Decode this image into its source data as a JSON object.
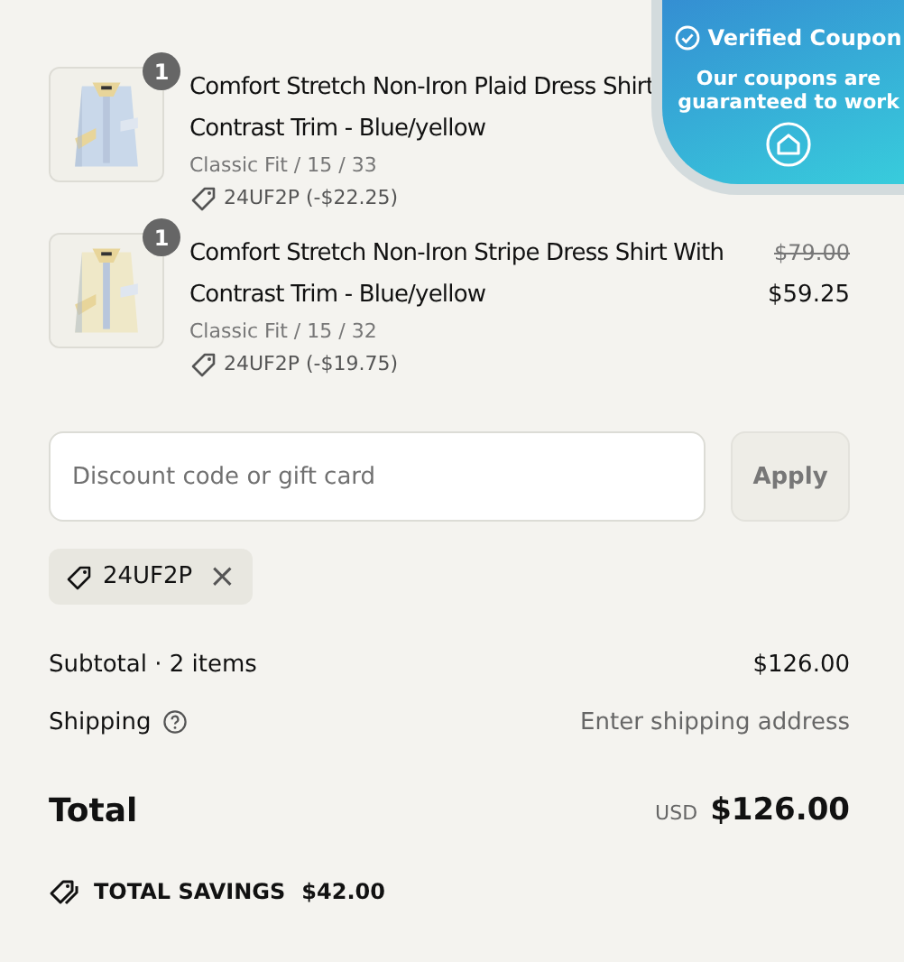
{
  "items": [
    {
      "quantity": "1",
      "title_lines": [
        "Comfort Stretch Non-Iron Plaid Dress Shirt",
        "Contrast Trim - Blue/yellow"
      ],
      "variant": "Classic Fit / 15 / 33",
      "discount": "24UF2P (-$22.25)"
    },
    {
      "quantity": "1",
      "title_lines": [
        "Comfort Stretch Non-Iron Stripe Dress Shirt With",
        "Contrast Trim - Blue/yellow"
      ],
      "variant": "Classic Fit / 15 / 32",
      "discount": "24UF2P (-$19.75)",
      "original_price": "$79.00",
      "price": "$59.25"
    }
  ],
  "discount_field": {
    "placeholder": "Discount code or gift card"
  },
  "apply_button": {
    "label": "Apply",
    "disabled": true
  },
  "applied_codes": [
    {
      "code": "24UF2P",
      "remove": "×"
    }
  ],
  "subtotal": {
    "label": "Subtotal · 2 items",
    "value": "$126.00"
  },
  "shipping": {
    "label": "Shipping",
    "value": "Enter shipping address"
  },
  "total": {
    "label": "Total",
    "currency": "USD",
    "value": "$126.00"
  },
  "savings": {
    "label": "TOTAL SAVINGS",
    "value": "$42.00"
  },
  "coupon_popup": {
    "title": "Verified Coupon",
    "message": "Our coupons are guaranteed to work"
  }
}
